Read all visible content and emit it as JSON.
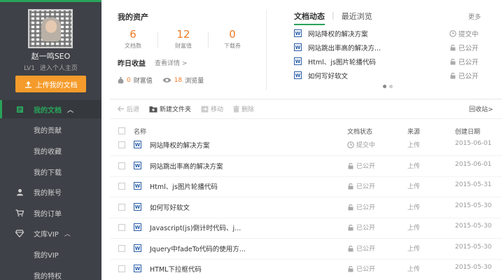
{
  "sidebar": {
    "username": "赵一鸣SEO",
    "level": "LV1",
    "personal_home": "进入个人主页",
    "upload_label": "上传我的文档",
    "nav": [
      {
        "label": "我的文档",
        "icon": "document-icon"
      },
      {
        "label": "我的贡献"
      },
      {
        "label": "我的收藏"
      },
      {
        "label": "我的下载"
      },
      {
        "label": "我的账号",
        "icon": "user-icon"
      },
      {
        "label": "我的订单",
        "icon": "cart-icon"
      },
      {
        "label": "文库VIP",
        "icon": "diamond-icon"
      },
      {
        "label": "我的VIP"
      },
      {
        "label": "我的特权"
      }
    ]
  },
  "assets": {
    "title": "我的资产",
    "stats": [
      {
        "value": "6",
        "label": "文档数"
      },
      {
        "value": "12",
        "label": "财富值"
      },
      {
        "value": "0",
        "label": "下载券"
      }
    ],
    "yesterday_title": "昨日收益",
    "yesterday_link": "查看详情 >",
    "wealth_value": "0",
    "wealth_label": "财富值",
    "views_value": "18",
    "views_label": "浏览量"
  },
  "recent": {
    "tab_active": "文档动态",
    "tab_other": "最近浏览",
    "more": "更多",
    "items": [
      {
        "title": "网站降权的解决方案",
        "status": "提交中"
      },
      {
        "title": "网站跳出率高的解决方...",
        "status": "已公开"
      },
      {
        "title": "Html、js图片轮播代码",
        "status": "已公开"
      },
      {
        "title": "如何写好软文",
        "status": "已公开"
      }
    ]
  },
  "toolbar": {
    "back": "后退",
    "new_folder": "新建文件夹",
    "move": "移动",
    "delete": "删除",
    "recycle": "回收站>"
  },
  "table": {
    "headers": {
      "name": "名称",
      "status": "文档状态",
      "source": "来源",
      "date": "创建日期"
    },
    "rows": [
      {
        "name": "网站降权的解决方案",
        "status": "提交中",
        "source": "上传",
        "date": "2015-06-01"
      },
      {
        "name": "网站跳出率高的解决方案",
        "status": "已公开",
        "source": "上传",
        "date": "2015-06-01"
      },
      {
        "name": "Html、js图片轮播代码",
        "status": "已公开",
        "source": "上传",
        "date": "2015-05-31"
      },
      {
        "name": "如何写好软文",
        "status": "已公开",
        "source": "上传",
        "date": "2015-05-30"
      },
      {
        "name": "Javascript(js)倒计时代码、j...",
        "status": "已公开",
        "source": "上传",
        "date": "2015-05-30"
      },
      {
        "name": "Jquery中fadeTo代码的使用方...",
        "status": "已公开",
        "source": "上传",
        "date": "2015-05-30"
      },
      {
        "name": "HTML下拉框代码",
        "status": "已公开",
        "source": "上传",
        "date": "2015-05-30"
      }
    ]
  },
  "colors": {
    "accent_green": "#29a35a",
    "orange": "#f07b26",
    "sidebar_bg": "#3e4147",
    "doc_blue": "#2a5ea8"
  }
}
